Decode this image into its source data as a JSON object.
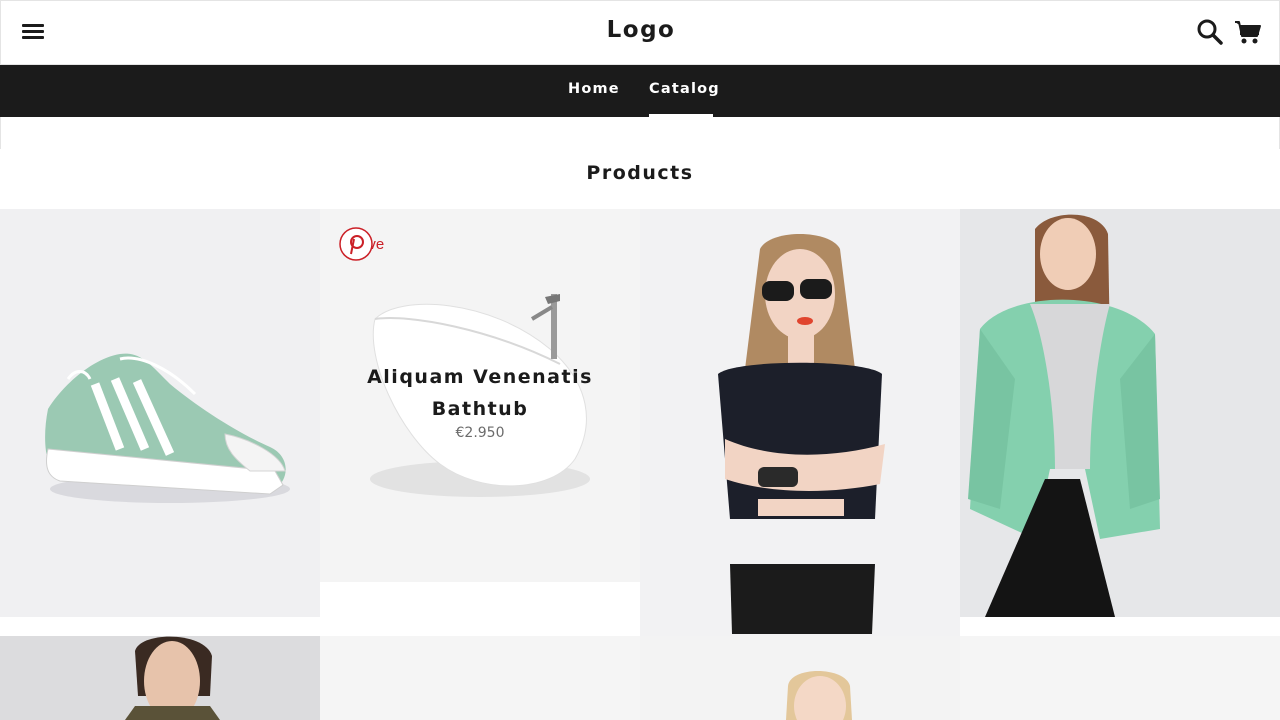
{
  "header": {
    "logo": "Logo",
    "menu_icon": "hamburger-menu-icon",
    "search_icon": "search-icon",
    "cart_icon": "cart-icon"
  },
  "nav": {
    "items": [
      {
        "label": "Home",
        "active": false
      },
      {
        "label": "Catalog",
        "active": true
      }
    ]
  },
  "page": {
    "title": "Products"
  },
  "products": [
    {
      "image": "green-sneaker"
    },
    {
      "image": "white-bathtub",
      "name_line1": "Aliquam Venenatis",
      "name_line2": "Bathtub",
      "price": "€2.950",
      "save_label": "Save",
      "save_icon": "pinterest-icon"
    },
    {
      "image": "woman-sunglasses"
    },
    {
      "image": "woman-green-jacket"
    },
    {
      "image": "man-portrait"
    },
    {
      "image": "blank"
    },
    {
      "image": "blonde-woman"
    },
    {
      "image": "blank"
    }
  ],
  "colors": {
    "nav_background": "#1b1b1b",
    "pinterest_red": "#cb2027",
    "accent_mint": "#7fc8a9"
  }
}
